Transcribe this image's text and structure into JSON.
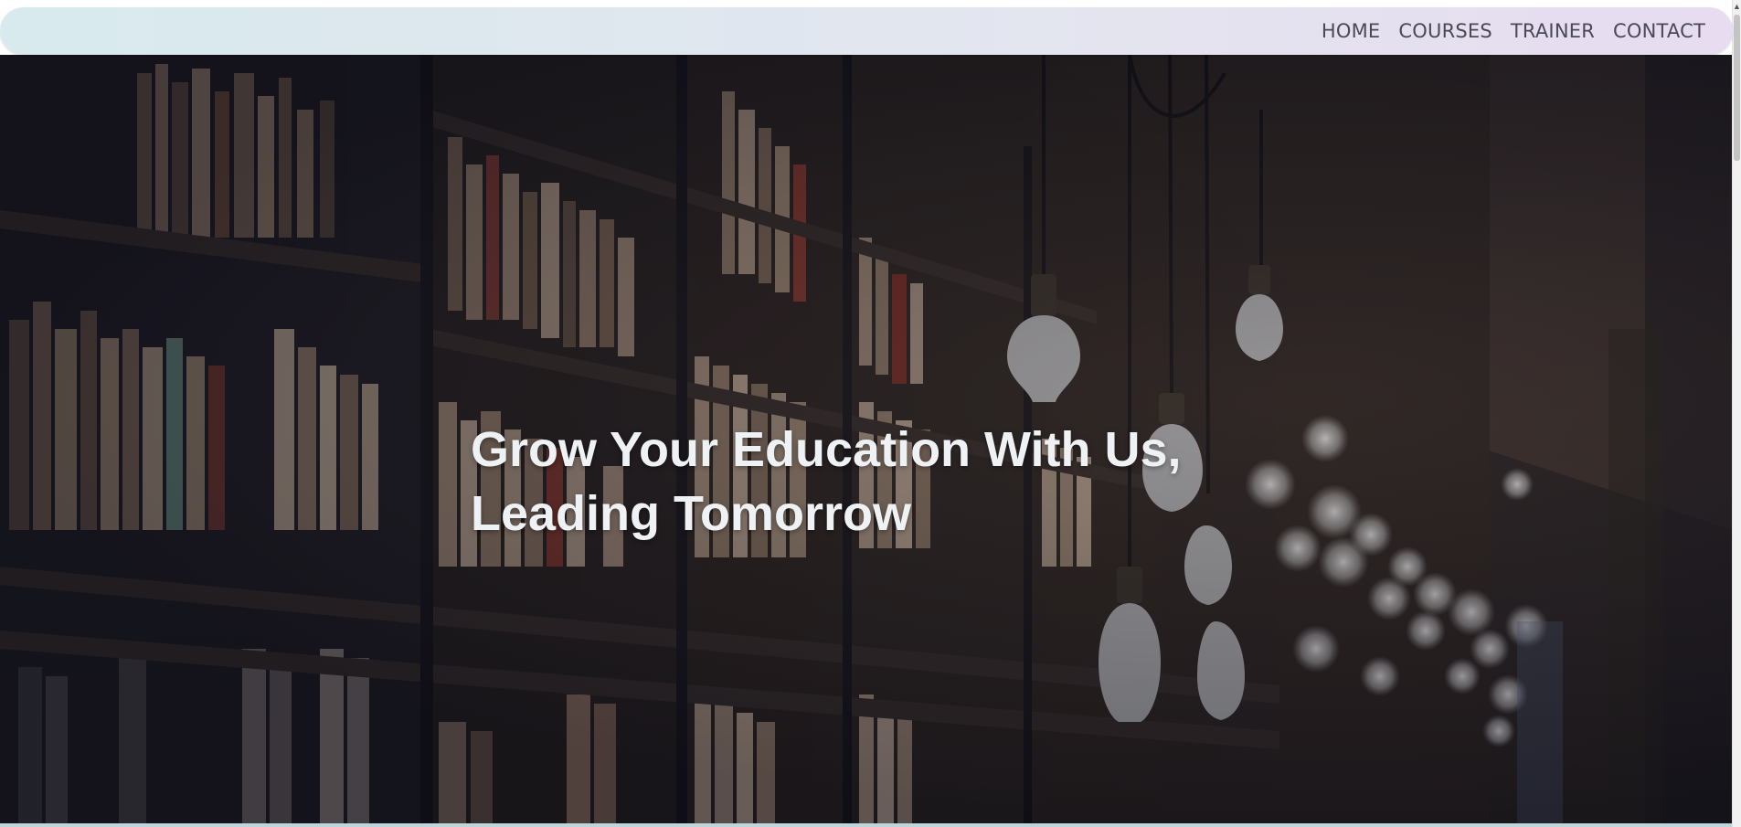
{
  "nav": {
    "items": [
      "HOME",
      "COURSES",
      "TRAINER",
      "CONTACT"
    ]
  },
  "hero": {
    "title_line1": "Grow Your Education With Us,",
    "title_line2": "Leading Tomorrow"
  },
  "icons": {
    "scroll_up": "triangle-up-icon"
  },
  "colors": {
    "nav_gradient_start": "#d8eaee",
    "nav_gradient_end": "#e7dcf0",
    "nav_text": "#4a4a55",
    "hero_text": "#eef2f4"
  }
}
